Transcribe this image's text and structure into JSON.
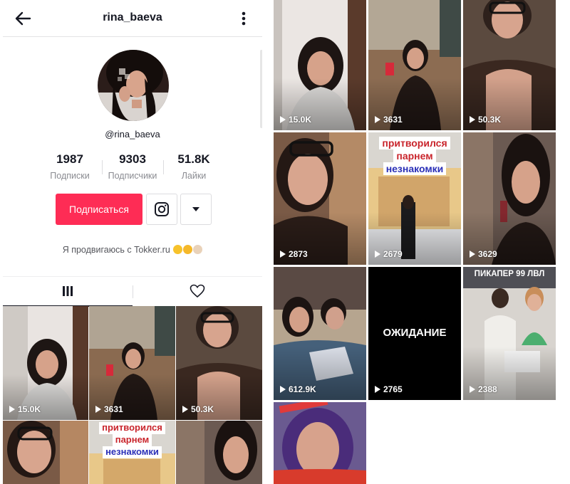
{
  "profile": {
    "username_title": "rina_baeva",
    "handle": "@rina_baeva",
    "stats": [
      {
        "value": "1987",
        "label": "Подписки"
      },
      {
        "value": "9303",
        "label": "Подписчики"
      },
      {
        "value": "51.8K",
        "label": "Лайки"
      }
    ],
    "follow_label": "Подписаться",
    "bio": "Я продвигаюсь с Tokker.ru",
    "colors": {
      "accent": "#fe2c55",
      "text": "#161823",
      "muted": "#8a8b91"
    },
    "icons": {
      "back": "arrow-left",
      "more": "vertical-dots",
      "instagram": "instagram-logo",
      "dropdown": "caret-down",
      "grid_tab": "grid-bars",
      "liked_tab": "heart-outline"
    }
  },
  "left_videos": [
    {
      "count": "15.0K"
    },
    {
      "count": "3631"
    },
    {
      "count": "50.3K"
    },
    {
      "count": ""
    },
    {
      "count": "",
      "caption_top": "притворился",
      "caption_mid": "парнем",
      "caption_bottom": "незнакомки"
    },
    {
      "count": ""
    }
  ],
  "right_videos": [
    {
      "count": "15.0K"
    },
    {
      "count": "3631"
    },
    {
      "count": "50.3K"
    },
    {
      "count": "2873"
    },
    {
      "count": "2679",
      "caption_top": "притворился",
      "caption_mid": "парнем",
      "caption_bottom": "незнакомки"
    },
    {
      "count": "3629"
    },
    {
      "count": "612.9K"
    },
    {
      "count": "2765",
      "caption_center": "ОЖИДАНИЕ"
    },
    {
      "count": "2388",
      "caption_top": "ПИКАПЕР 99 ЛВЛ"
    },
    {
      "count": ""
    }
  ]
}
